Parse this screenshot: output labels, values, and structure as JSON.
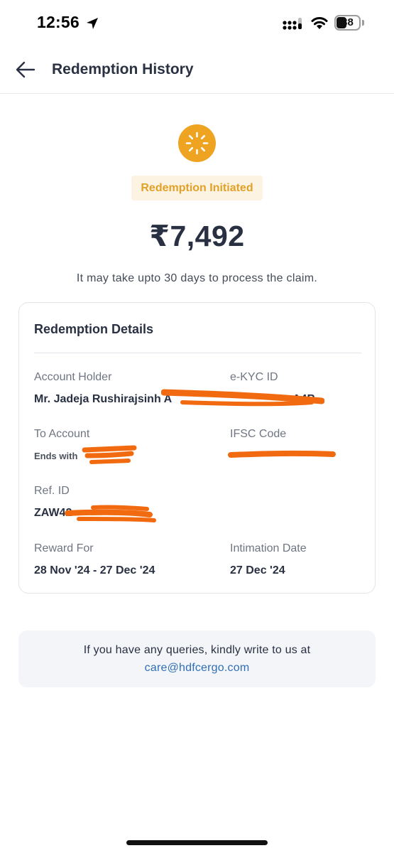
{
  "status_bar": {
    "time": "12:56",
    "battery": "38",
    "icons": [
      "location-arrow-icon",
      "cellular-signal-icon",
      "wifi-icon",
      "battery-icon"
    ]
  },
  "header": {
    "title": "Redemption History",
    "back_icon": "arrow-left-icon"
  },
  "status": {
    "icon": "loading-spinner-icon",
    "badge": "Redemption Initiated",
    "amount": "₹7,492",
    "note": "It may take upto 30 days to process the claim."
  },
  "details": {
    "title": "Redemption Details",
    "account_holder": {
      "label": "Account Holder",
      "value": "Mr. Jadeja Rushirajsinh A"
    },
    "ekyc_id": {
      "label": "e-KYC ID",
      "value": "A4B"
    },
    "to_account": {
      "label": "To Account",
      "value": "Ends with"
    },
    "ifsc": {
      "label": "IFSC Code",
      "value": ""
    },
    "ref_id": {
      "label": "Ref. ID",
      "value": "ZAW42"
    },
    "reward_for": {
      "label": "Reward For",
      "value": "28 Nov '24 - 27 Dec '24"
    },
    "intimation_date": {
      "label": "Intimation Date",
      "value": "27 Dec '24"
    }
  },
  "query": {
    "text": "If you have any queries, kindly write to us at",
    "email": "care@hdfcergo.com"
  },
  "colors": {
    "accent_orange": "#eea321",
    "badge_bg": "#fdf3e2",
    "badge_text": "#e2a128",
    "link_blue": "#2f6fb6",
    "redaction": "#f26a0f"
  }
}
